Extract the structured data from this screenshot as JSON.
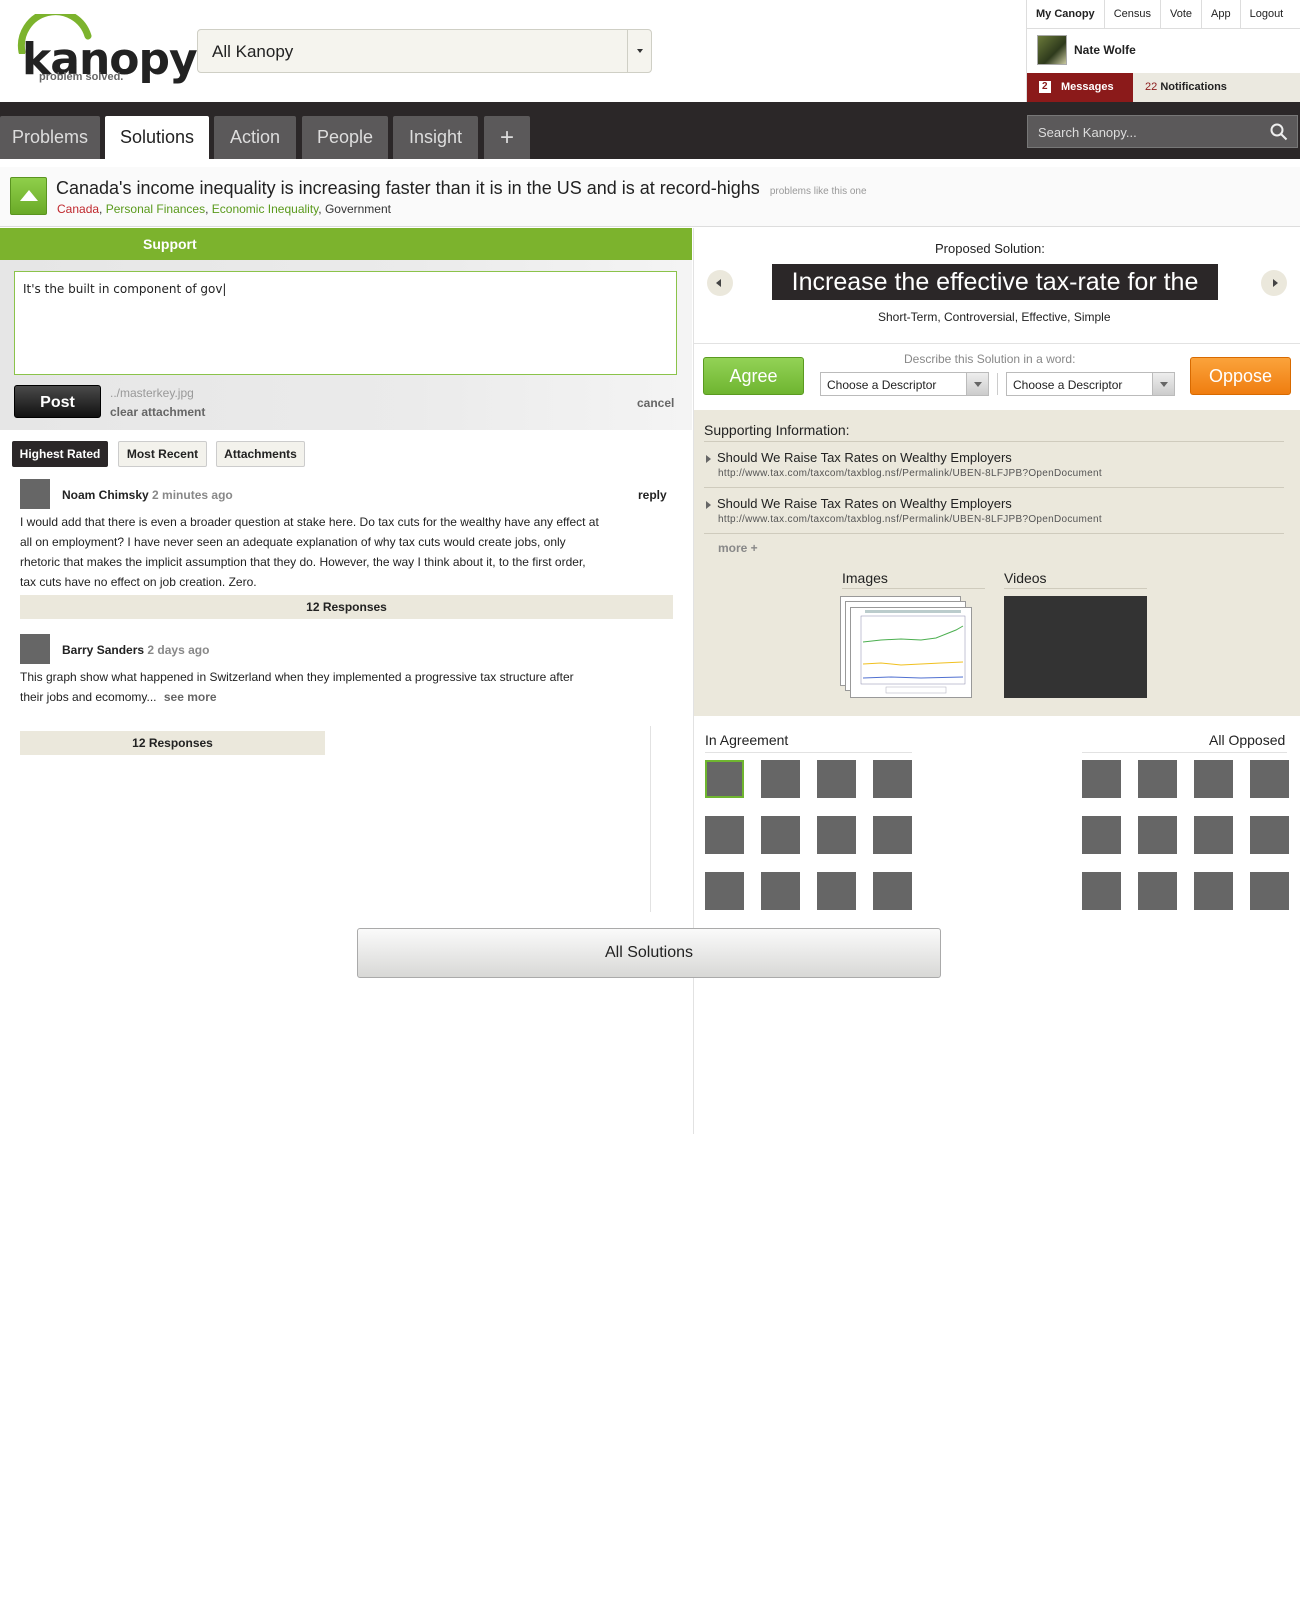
{
  "brand": {
    "name": "kanopy",
    "tagline": "problem solved."
  },
  "scope": {
    "selected": "All Kanopy"
  },
  "topnav": [
    "My Canopy",
    "Census",
    "Vote",
    "App",
    "Logout"
  ],
  "user": {
    "name": "Nate Wolfe"
  },
  "messages": {
    "count": "2",
    "label": "Messages"
  },
  "notifications": {
    "count": "22",
    "label": "Notifications"
  },
  "tabs": [
    "Problems",
    "Solutions",
    "Action",
    "People",
    "Insight",
    "+"
  ],
  "active_tab": "Solutions",
  "search": {
    "placeholder": "Search Kanopy..."
  },
  "problem": {
    "title": "Canada's income inequality is increasing faster than it is in the US and is at record-highs",
    "similar": "problems like this one",
    "tags": [
      "Canada",
      "Personal Finances",
      "Economic Inequality",
      "Government"
    ]
  },
  "support": {
    "header": "Support",
    "draft": "It's the built in component of gov|",
    "post_label": "Post",
    "attachment": "../masterkey.jpg",
    "clear_attachment": "clear attachment",
    "cancel": "cancel"
  },
  "sort": [
    "Highest Rated",
    "Most Recent",
    "Attachments"
  ],
  "comments": [
    {
      "author": "Noam Chimsky",
      "time": "2 minutes ago",
      "lines": [
        "I would add that there is even a broader question at stake here. Do tax cuts for the wealthy have any effect at",
        "all on employment? I have never seen an adequate explanation of why tax cuts would create jobs, only",
        "rhetoric that makes the implicit assumption that they do. However, the way I think about it, to the first order,",
        "tax cuts have no effect on job creation. Zero."
      ],
      "reply": "reply",
      "responses": "12 Responses"
    },
    {
      "author": "Barry Sanders",
      "time": "2 days ago",
      "lines": [
        "This graph show what happened in Switzerland when they implemented a progressive tax structure after",
        "their jobs and ecomomy..."
      ],
      "see_more": "see more",
      "responses": "12 Responses"
    }
  ],
  "all_solutions": "All Solutions",
  "solution": {
    "label": "Proposed Solution:",
    "title": "Increase the effective tax-rate for the rich",
    "descriptors": "Short-Term, Controversial, Effective, Simple"
  },
  "vote": {
    "agree": "Agree",
    "oppose": "Oppose",
    "describe": "Describe this Solution in a word:",
    "select1": "Choose a Descriptor",
    "select2": "Choose a Descriptor"
  },
  "supporting": {
    "title": "Supporting Information:",
    "items": [
      {
        "title": "Should We Raise Tax Rates on Wealthy Employers",
        "url": "http://www.tax.com/taxcom/taxblog.nsf/Permalink/UBEN-8LFJPB?OpenDocument"
      },
      {
        "title": "Should We Raise Tax Rates on Wealthy Employers",
        "url": "http://www.tax.com/taxcom/taxblog.nsf/Permalink/UBEN-8LFJPB?OpenDocument"
      }
    ],
    "more": "more +",
    "images_label": "Images",
    "videos_label": "Videos"
  },
  "participants": {
    "agree_label": "In Agreement",
    "oppose_label": "All Opposed"
  },
  "colors": {
    "accent_green": "#7cb32d",
    "oppose_orange": "#f08a1f",
    "dark": "#2b2728",
    "messages_red": "#8b1a1a"
  }
}
